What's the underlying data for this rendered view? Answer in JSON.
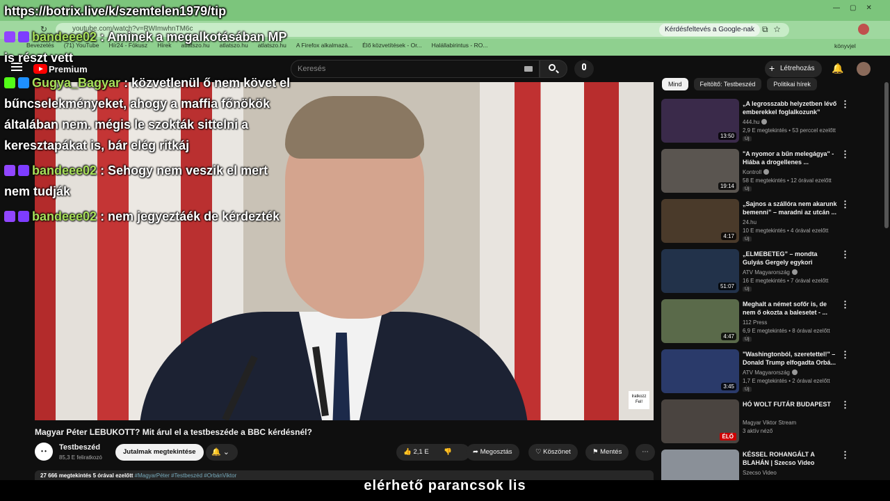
{
  "browser": {
    "url": "youtube.com/watch?v=RWImwhnTM6c",
    "google_search_label": "Kérdésfeltevés a Google-nak",
    "bookmarks": [
      "Bevezetés",
      "(71) YouTube",
      "Hír24 - Fókusz",
      "Hírek",
      "atlatszo.hu",
      "atlatszo.hu",
      "atlatszo.hu",
      "A Firefox alkalmazá...",
      "Élő közvetítések - Or...",
      "Halállabirintus - RO..."
    ],
    "bookmarks_right": "könyvjel"
  },
  "overlay": {
    "url": "https://botrix.live/k/szemtelen1979/tip",
    "chat": [
      {
        "user": "bandeee02",
        "text": " : Aminek a megalkotásában MP is részt vett"
      },
      {
        "user": "Gugya_Bagyar",
        "text": " : közvetlenül ő nem követ el bűncselekményeket, ahogy a maffia főnökök általában nem. mégis le szokták sittelni a keresztapákat is, bár elég ritkáj"
      },
      {
        "user": "bandeee02",
        "text": " : Sehogy nem veszik el mert nem tudják"
      },
      {
        "user": "bandeee02",
        "text": " : nem jegyeztáék de kérdezték"
      }
    ]
  },
  "header": {
    "logo_text": "Premium",
    "search_placeholder": "Keresés",
    "create_label": "Létrehozás"
  },
  "video": {
    "title": "Magyar Péter LEBUKOTT? Mit árul el a testbeszéde a BBC kérdésnél?",
    "watermark": "Iratkozz Fel!",
    "channel_avatar_text": "• •",
    "channel": "Testbeszéd",
    "subscribers": "85,3 E feliratkozó",
    "perks_label": "Jutalmak megtekintése",
    "likes": "2,1 E",
    "share_label": "Megosztás",
    "thanks_label": "Köszönet",
    "save_label": "Mentés",
    "description_views": "27 666 megtekintés  5 órával ezelőtt",
    "description_tags": "#MagyarPéter #Testbeszéd #OrbánViktor"
  },
  "sidebar": {
    "chips": [
      "Mind",
      "Feltöltő: Testbeszéd",
      "Politikai hírek"
    ],
    "items": [
      {
        "title": "„A legrosszabb helyzetben lévő emberekkel foglalkozunk”",
        "channel": "444.hu",
        "verified": true,
        "meta": "2,9 E megtekintés • 53 perccel ezelőtt",
        "badge": "Új",
        "duration": "13:50",
        "thumb_color": "#3a2a4a"
      },
      {
        "title": "\"A nyomor a bűn melegágya\" - Hiába a drogellenes ...",
        "channel": "Kontroll",
        "verified": true,
        "meta": "58 E megtekintés • 12 órával ezelőtt",
        "badge": "Új",
        "duration": "19:14",
        "thumb_color": "#5a5550"
      },
      {
        "title": "„Sajnos a szállóra nem akarunk bemenni” – maradni az utcán ...",
        "channel": "24.hu",
        "verified": false,
        "meta": "10 E megtekintés • 4 órával ezelőtt",
        "badge": "Új",
        "duration": "4:17",
        "thumb_color": "#4a3a2a"
      },
      {
        "title": "„ELMEBETEG” – mondta Gulyás Gergely egykori barátjáról, ...",
        "channel": "ATV Magyarország",
        "verified": true,
        "meta": "16 E megtekintés • 7 órával ezelőtt",
        "badge": "Új",
        "duration": "51:07",
        "thumb_color": "#22324a"
      },
      {
        "title": "Meghalt a német sofőr is, de nem ő okozta a balesetet - ...",
        "channel": "112 Press",
        "verified": false,
        "meta": "6,9 E megtekintés • 8 órával ezelőtt",
        "badge": "Új",
        "duration": "4:47",
        "thumb_color": "#5a6a4a"
      },
      {
        "title": "\"Washingtonból, szeretettel!\" – Donald Trump elfogadta Orbá...",
        "channel": "ATV Magyarország",
        "verified": true,
        "meta": "1,7 E megtekintés • 2 órával ezelőtt",
        "badge": "Új",
        "duration": "3:45",
        "thumb_color": "#2a3a6a"
      },
      {
        "title": "HÓ WOLT FUTÁR BUDAPEST",
        "channel": "Magyar Viktor Stream",
        "verified": false,
        "meta": "3 aktív néző",
        "badge": "",
        "duration": "ÉLŐ",
        "thumb_color": "#4a4440"
      },
      {
        "title": "KÉSSEL ROHANGÁLT A BLAHÁN | Szecso Video",
        "channel": "Szecso Video",
        "verified": false,
        "meta": "",
        "badge": "",
        "duration": "",
        "thumb_color": "#8a9098"
      }
    ]
  },
  "caption": "elérhető parancsok lis",
  "colors": {
    "accent": "#ff0000",
    "chat_username": "#a8e05a",
    "chrome": "#8fd08f"
  }
}
